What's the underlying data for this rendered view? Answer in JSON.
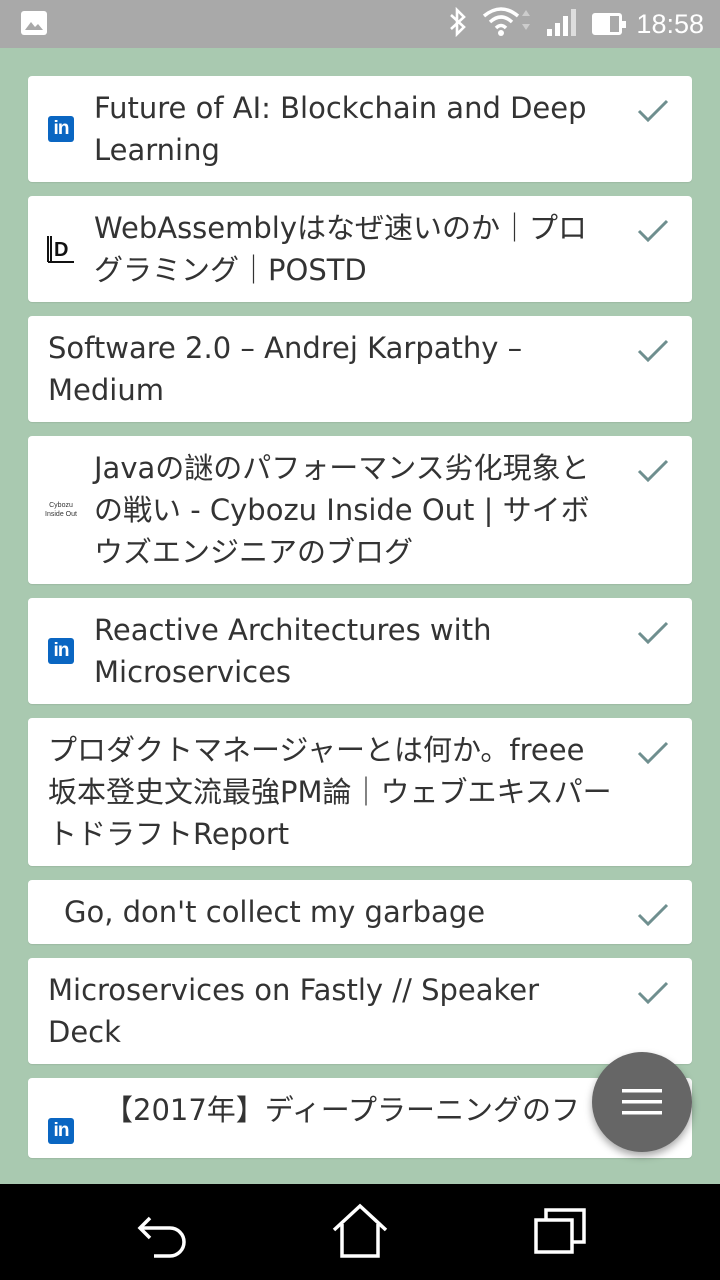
{
  "status_bar": {
    "time": "18:58",
    "battery_level": 0.6,
    "icons": [
      "image-icon",
      "bluetooth-icon",
      "wifi-icon",
      "signal-icon",
      "battery-icon"
    ]
  },
  "items": [
    {
      "title": "Future of AI: Blockchain and Deep Learning",
      "icon": "linkedin-icon",
      "read": true
    },
    {
      "title": "WebAssemblyはなぜ速いのか｜プログラミング｜POSTD",
      "icon": "postd-icon",
      "read": true
    },
    {
      "title": "Software 2.0 – Andrej Karpathy – Medium",
      "icon": "",
      "read": true
    },
    {
      "title": "Javaの謎のパフォーマンス劣化現象との戦い - Cybozu Inside Out | サイボウズエンジニアのブログ",
      "icon": "cybozu-icon",
      "icon_text": "Cybozu Inside Out",
      "read": true
    },
    {
      "title": "Reactive Architectures with Microservices",
      "icon": "linkedin-icon",
      "read": true
    },
    {
      "title": "プロダクトマネージャーとは何か。freee坂本登史文流最強PM論｜ウェブエキスパートドラフトReport",
      "icon": "",
      "read": true
    },
    {
      "title": "Go, don't collect my garbage",
      "icon": "",
      "read": true
    },
    {
      "title": "Microservices on Fastly // Speaker Deck",
      "icon": "",
      "read": true
    },
    {
      "title": "【2017年】ディープラーニングのフ",
      "icon": "linkedin-icon",
      "read": true
    }
  ],
  "colors": {
    "background": "#a9c9b0",
    "status_bar": "#a9a9a9",
    "linkedin": "#0a66c2",
    "check": "#6f8f8f",
    "fab": "#666666"
  }
}
